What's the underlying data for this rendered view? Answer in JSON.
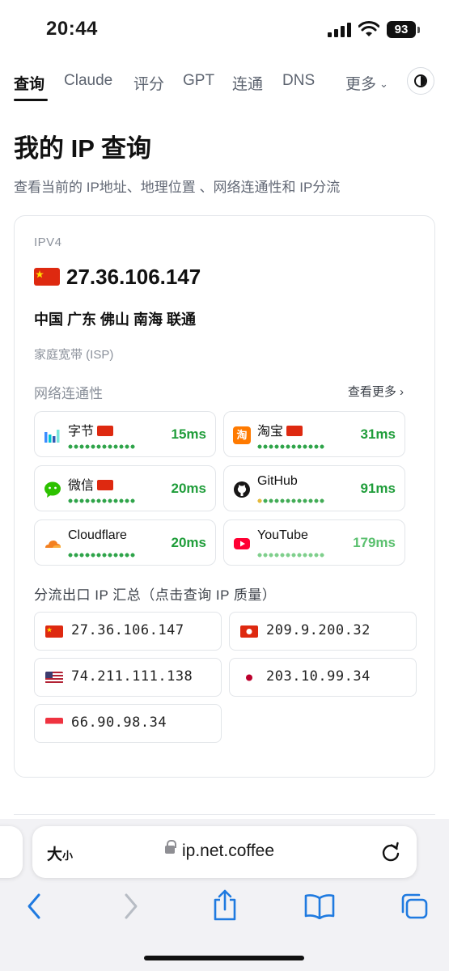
{
  "status_bar": {
    "time": "20:44",
    "battery": "93"
  },
  "nav": {
    "tabs": [
      {
        "label": "查询",
        "active": true
      },
      {
        "label": "Claude"
      },
      {
        "label": "评分"
      },
      {
        "label": "GPT"
      },
      {
        "label": "连通"
      },
      {
        "label": "DNS"
      }
    ],
    "more_label": "更多",
    "theme_toggle_icon": "contrast-icon"
  },
  "page": {
    "title": "我的 IP 查询",
    "subtitle": "查看当前的 IP地址、地理位置 、网络连通性和 IP分流"
  },
  "ip_card": {
    "version_label": "IPV4",
    "ip": "27.36.106.147",
    "location": "中国 广东 佛山 南海 联通",
    "isp": "家庭宽带 (ISP)",
    "connectivity_label": "网络连通性",
    "see_more_label": "查看更多 ›",
    "sites": [
      {
        "name": "字节",
        "latency": "15ms",
        "cn_flag": true,
        "icon": "bytedance-icon"
      },
      {
        "name": "淘宝",
        "latency": "31ms",
        "cn_flag": true,
        "icon": "taobao-icon"
      },
      {
        "name": "微信",
        "latency": "20ms",
        "cn_flag": true,
        "icon": "wechat-icon"
      },
      {
        "name": "GitHub",
        "latency": "91ms",
        "cn_flag": false,
        "icon": "github-icon"
      },
      {
        "name": "Cloudflare",
        "latency": "20ms",
        "cn_flag": false,
        "icon": "cloudflare-icon"
      },
      {
        "name": "YouTube",
        "latency": "179ms",
        "cn_flag": false,
        "icon": "youtube-icon"
      }
    ],
    "routes_label": "分流出口 IP 汇总（点击查询 IP 质量）",
    "routes": [
      {
        "ip": "27.36.106.147",
        "flag": "china-flag-icon"
      },
      {
        "ip": "209.9.200.32",
        "flag": "hongkong-flag-icon"
      },
      {
        "ip": "74.211.111.138",
        "flag": "usa-flag-icon"
      },
      {
        "ip": "203.10.99.34",
        "flag": "japan-flag-icon"
      },
      {
        "ip": "66.90.98.34",
        "flag": "singapore-flag-icon"
      }
    ]
  },
  "browser": {
    "text_size_big": "大",
    "text_size_small": "小",
    "url": "ip.net.coffee",
    "icons": [
      "back-icon",
      "forward-icon",
      "share-icon",
      "bookmarks-icon",
      "tabs-icon",
      "reload-icon",
      "lock-icon"
    ]
  },
  "colors": {
    "latency_good": "#1f9d3a",
    "latency_slow": "#5bc06f",
    "china_red": "#de2910"
  }
}
